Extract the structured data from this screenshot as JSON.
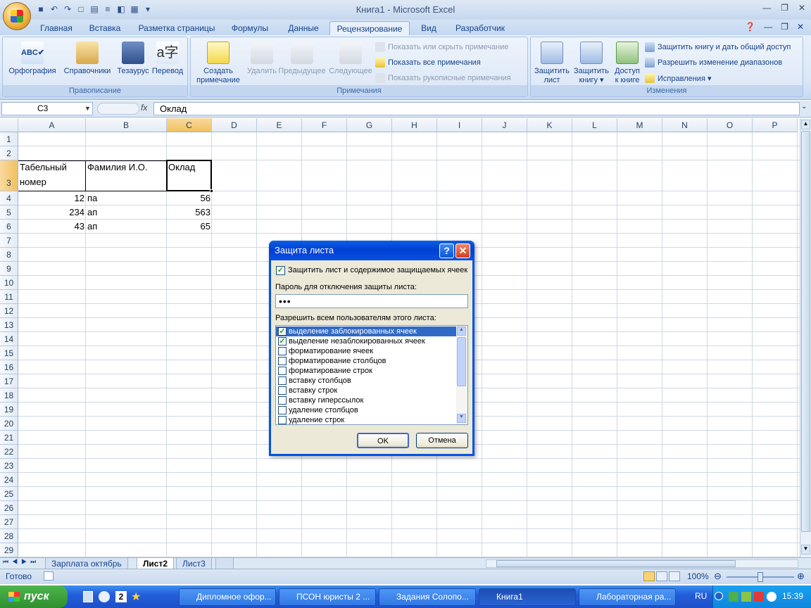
{
  "window": {
    "title": "Книга1 - Microsoft Excel"
  },
  "tabs": [
    "Главная",
    "Вставка",
    "Разметка страницы",
    "Формулы",
    "Данные",
    "Рецензирование",
    "Вид",
    "Разработчик"
  ],
  "active_tab": "Рецензирование",
  "ribbon": {
    "proofing": {
      "title": "Правописание",
      "buttons": [
        "Орфография",
        "Справочники",
        "Тезаурус",
        "Перевод"
      ]
    },
    "comments": {
      "title": "Примечания",
      "create_line1": "Создать",
      "create_line2": "примечание",
      "delete": "Удалить",
      "previous": "Предыдущее",
      "next": "Следующее",
      "show_hide": "Показать или скрыть примечание",
      "show_all": "Показать все примечания",
      "show_ink": "Показать рукописные примечания"
    },
    "changes": {
      "title": "Изменения",
      "protect_sheet_1": "Защитить",
      "protect_sheet_2": "лист",
      "protect_book_1": "Защитить",
      "protect_book_2": "книгу ▾",
      "share_1": "Доступ",
      "share_2": "к книге",
      "protect_share": "Защитить книгу и дать общий доступ",
      "allow_ranges": "Разрешить изменение диапазонов",
      "track": "Исправления ▾"
    }
  },
  "formula_bar": {
    "name_box": "C3",
    "fx": "fx",
    "value": "Оклад"
  },
  "grid": {
    "columns": [
      "A",
      "B",
      "C",
      "D",
      "E",
      "F",
      "G",
      "H",
      "I",
      "J",
      "K",
      "L",
      "M",
      "N",
      "O",
      "P"
    ],
    "rows": [
      "1",
      "2",
      "3",
      "4",
      "5",
      "6",
      "7",
      "8",
      "9",
      "10",
      "11",
      "12",
      "13",
      "14",
      "15",
      "16",
      "17",
      "18",
      "19",
      "20",
      "21",
      "22",
      "23",
      "24",
      "25",
      "26",
      "27",
      "28",
      "29"
    ],
    "cells": {
      "A3a": "Табельный",
      "A3b": "номер",
      "B3": "Фамилия И.О.",
      "C3": "Оклад",
      "A4": "12",
      "B4": "па",
      "C4": "56",
      "A5": "234",
      "B5": "ап",
      "C5": "563",
      "A6": "43",
      "B6": "ап",
      "C6": "65"
    }
  },
  "sheet_tabs": [
    "Зарплата октябрь",
    "Лист2",
    "Лист3"
  ],
  "active_sheet": "Лист2",
  "status": {
    "ready": "Готово",
    "zoom": "100%"
  },
  "dialog": {
    "title": "Защита листа",
    "help": "?",
    "close": "✕",
    "protect_label": "Защитить лист и содержимое защищаемых ячеек",
    "protect_checked": true,
    "password_label": "Пароль для отключения защиты листа:",
    "password_value": "•••",
    "allow_label": "Разрешить всем пользователям этого листа:",
    "permissions": [
      {
        "label": "выделение заблокированных ячеек",
        "checked": true
      },
      {
        "label": "выделение незаблокированных ячеек",
        "checked": true
      },
      {
        "label": "форматирование ячеек",
        "checked": false
      },
      {
        "label": "форматирование столбцов",
        "checked": false
      },
      {
        "label": "форматирование строк",
        "checked": false
      },
      {
        "label": "вставку столбцов",
        "checked": false
      },
      {
        "label": "вставку строк",
        "checked": false
      },
      {
        "label": "вставку гиперссылок",
        "checked": false
      },
      {
        "label": "удаление столбцов",
        "checked": false
      },
      {
        "label": "удаление строк",
        "checked": false
      }
    ],
    "ok": "OK",
    "cancel": "Отмена"
  },
  "taskbar": {
    "start": "пуск",
    "quick_launch_number": "2",
    "buttons": [
      "Дипломное офор...",
      "ПСОН юристы 2 ...",
      "Задания Солопо...",
      "Книга1",
      "Лабораторная ра..."
    ],
    "active": "Книга1",
    "lang": "RU",
    "clock": "15:39"
  }
}
